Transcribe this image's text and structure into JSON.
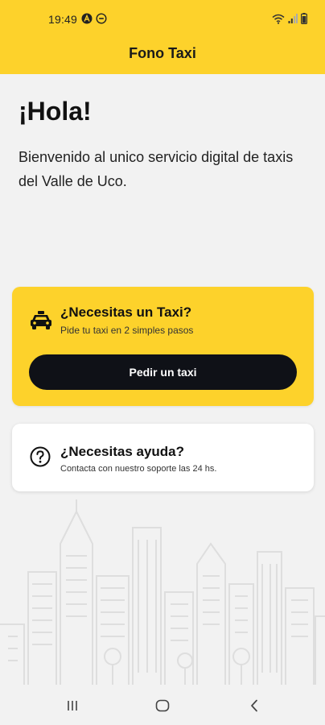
{
  "status_bar": {
    "time": "19:49",
    "icons_left": [
      "accessibility-icon",
      "minus-circle-icon"
    ],
    "icons_right": [
      "wifi-icon",
      "signal-icon",
      "battery-icon"
    ]
  },
  "header": {
    "title": "Fono Taxi",
    "background_color": "#fdd22b"
  },
  "main": {
    "greeting": "¡Hola!",
    "welcome_text": "Bienvenido al unico servicio digital de taxis del Valle de Uco."
  },
  "taxi_card": {
    "icon": "taxi-icon",
    "title": "¿Necesitas un Taxi?",
    "subtitle": "Pide tu taxi en 2 simples pasos",
    "button_label": "Pedir un taxi",
    "background_color": "#fdd22b",
    "button_color": "#0f1117"
  },
  "help_card": {
    "icon": "help-circle-icon",
    "title": "¿Necesitas ayuda?",
    "subtitle": "Contacta con nuestro soporte las 24 hs."
  },
  "nav_bar": {
    "buttons": [
      "recent-apps-icon",
      "home-icon",
      "back-icon"
    ]
  }
}
